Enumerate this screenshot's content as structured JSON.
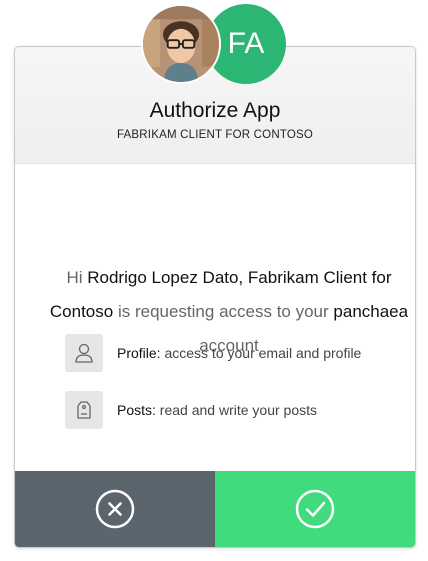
{
  "header": {
    "title": "Authorize App",
    "subtitle": "FABRIKAM CLIENT FOR CONTOSO",
    "app_initials": "FA",
    "app_color": "#2bb673"
  },
  "message": {
    "greeting": "Hi",
    "user_name": "Rodrigo Lopez Dato,",
    "client_name": "Fabrikam Client for Contoso",
    "middle": "is requesting access to your",
    "account_name": "panchaea",
    "tail": "account"
  },
  "permissions": [
    {
      "icon": "person-icon",
      "label": "Profile:",
      "description": "access to your email and profile"
    },
    {
      "icon": "tag-icon",
      "label": "Posts:",
      "description": "read and write your posts"
    }
  ],
  "actions": {
    "deny_icon": "close-circle-icon",
    "deny_color": "#5b656e",
    "allow_icon": "check-circle-icon",
    "allow_color": "#3fdb7c"
  }
}
